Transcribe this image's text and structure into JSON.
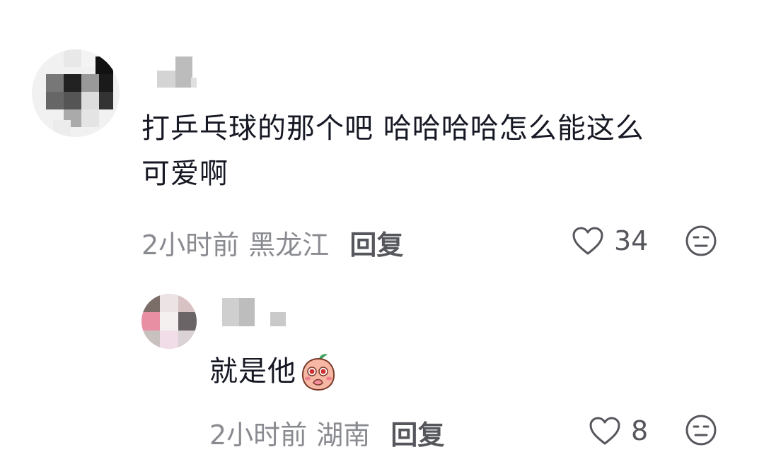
{
  "comments": [
    {
      "text_line1": "打乒乓球的那个吧 哈哈哈哈怎么能这么",
      "text_line2": "可爱啊",
      "time": "2小时前",
      "location": "黑龙江",
      "reply_label": "回复",
      "like_count": "34"
    },
    {
      "text": "就是他",
      "time": "2小时前",
      "location": "湖南",
      "reply_label": "回复",
      "like_count": "8"
    }
  ],
  "icons": {
    "like": "heart-outline-icon",
    "dislike": "neutral-face-icon",
    "emoji": "peach-shy-emoji"
  }
}
